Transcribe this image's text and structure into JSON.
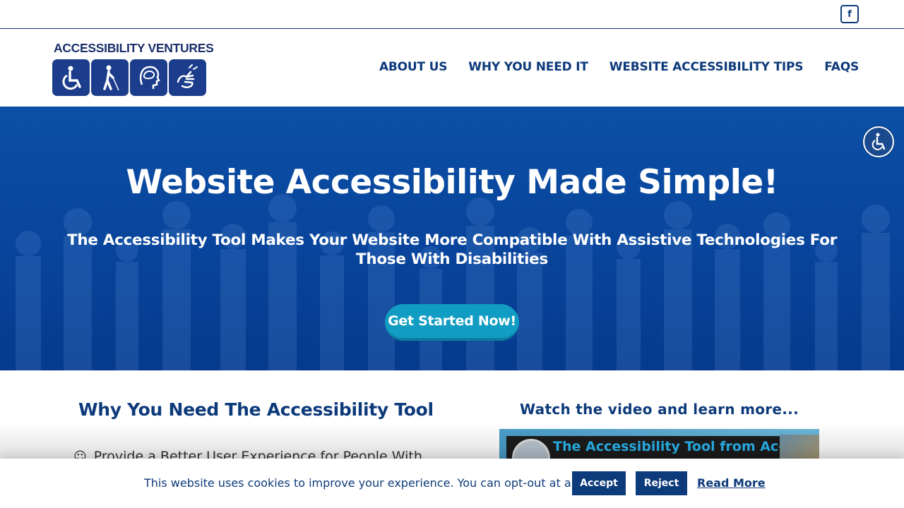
{
  "topbar": {
    "facebook_icon": "f"
  },
  "logo": {
    "text": "ACCESSIBILITY VENTURES",
    "tiles": [
      "wheelchair-icon",
      "blind-walker-icon",
      "brain-head-icon",
      "sign-language-icon"
    ]
  },
  "nav": {
    "items": [
      {
        "label": "ABOUT US"
      },
      {
        "label": "WHY YOU NEED IT"
      },
      {
        "label": "WEBSITE ACCESSIBILITY TIPS"
      },
      {
        "label": "FAQS"
      }
    ]
  },
  "hero": {
    "title": "Website Accessibility Made Simple!",
    "subtitle": "The Accessibility Tool Makes Your Website More Compatible With Assistive Technologies For Those With Disabilities",
    "cta_label": "Get Started Now!"
  },
  "accessibility_widget": {
    "icon": "wheelchair-icon"
  },
  "content": {
    "left_title": "Why You Need The Accessibility Tool",
    "bullet_icon": "☺",
    "bullet_text": "Provide a Better User Experience for People With",
    "video_heading": "Watch the video and learn more...",
    "video_caption": "The Accessibility Tool from Ac-"
  },
  "cookie": {
    "message": "This website uses cookies to improve your experience. You can opt-out at any time.",
    "accept_label": "Accept",
    "reject_label": "Reject",
    "read_more_label": "Read More"
  },
  "colors": {
    "brand": "#0d3a7a",
    "hero_bg": "#08439a",
    "cta": "#119dc3"
  }
}
